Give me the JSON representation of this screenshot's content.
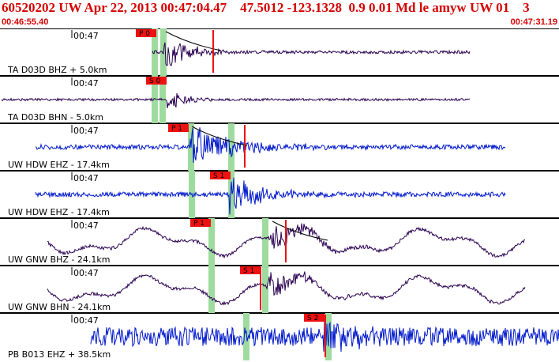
{
  "header": {
    "title": "60520202 UW Apr 22, 2013 00:47:04.47    47.5012 -123.1328  0.9 0.01 Md le amyw UW 01    3",
    "start_time": "00:46:55.40",
    "end_time": "00:47:31.19"
  },
  "colors": {
    "accent_red": "#d40000",
    "trace_blue": "#0018cc",
    "trace_dark": "#2a0050",
    "highlight_green": "#9fdb9f",
    "pick_red": "#ee1111"
  },
  "channels": [
    {
      "label": "TA D03D BHZ + 5.0km",
      "time_label": "00:47",
      "pick": "P 0",
      "color": "dark"
    },
    {
      "label": "TA D03D BHN - 5.0km",
      "time_label": "00:47",
      "pick": "S 0",
      "color": "dark"
    },
    {
      "label": "UW HDW EHZ - 17.4km",
      "time_label": "00:47",
      "pick": "P 1",
      "color": "blue"
    },
    {
      "label": "UW HDW EHZ - 17.4km",
      "time_label": "00:47",
      "pick": "S 1",
      "color": "blue"
    },
    {
      "label": "UW GNW BHZ - 24.1km",
      "time_label": "00:47",
      "pick": "P 1",
      "color": "dark"
    },
    {
      "label": "UW GNW BHN - 24.1km",
      "time_label": "00:47",
      "pick": "S 1",
      "color": "dark"
    },
    {
      "label": "PB B013 EHZ + 38.5km",
      "time_label": "00:47",
      "pick": "S 2",
      "color": "blue"
    }
  ]
}
